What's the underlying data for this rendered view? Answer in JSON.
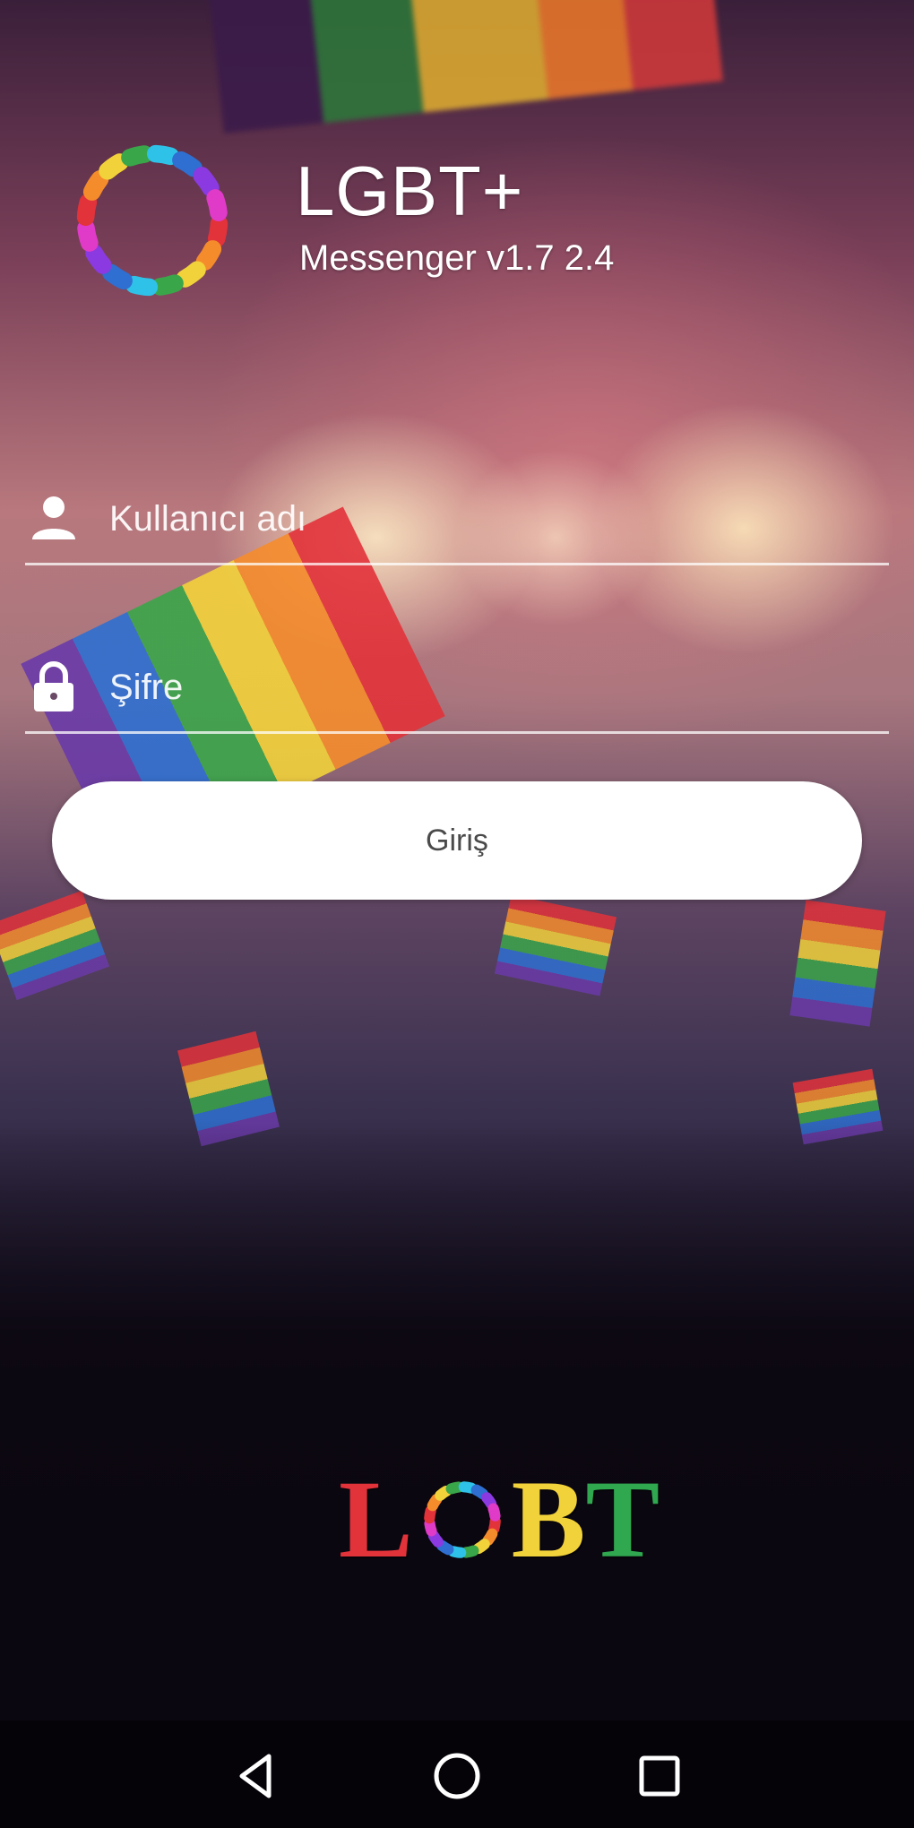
{
  "header": {
    "app_title": "LGBT+",
    "app_subtitle": "Messenger v1.7 2.4",
    "logo_icon": "rainbow-ring-logo"
  },
  "form": {
    "username": {
      "placeholder": "Kullanıcı adı",
      "value": "",
      "icon": "person-icon"
    },
    "password": {
      "placeholder": "Şifre",
      "value": "",
      "icon": "lock-icon"
    },
    "login_label": "Giriş"
  },
  "footer_logo": {
    "letters": [
      {
        "char": "L",
        "color": "#e2323a"
      },
      {
        "char": "B",
        "color": "#f2d23a"
      },
      {
        "char": "T",
        "color": "#2fa84f"
      }
    ],
    "ring_icon": "rainbow-ring-logo"
  },
  "navbar": {
    "back_icon": "back-triangle-icon",
    "home_icon": "home-circle-icon",
    "recents_icon": "recents-square-icon"
  },
  "colors": {
    "ring": [
      "#e2323a",
      "#f58c2c",
      "#f2d23a",
      "#3aa64a",
      "#2ec2e8",
      "#2e6fd1",
      "#8a3ae0",
      "#e03ac8"
    ],
    "button_bg": "#ffffff",
    "button_text": "#4a4a4a"
  }
}
